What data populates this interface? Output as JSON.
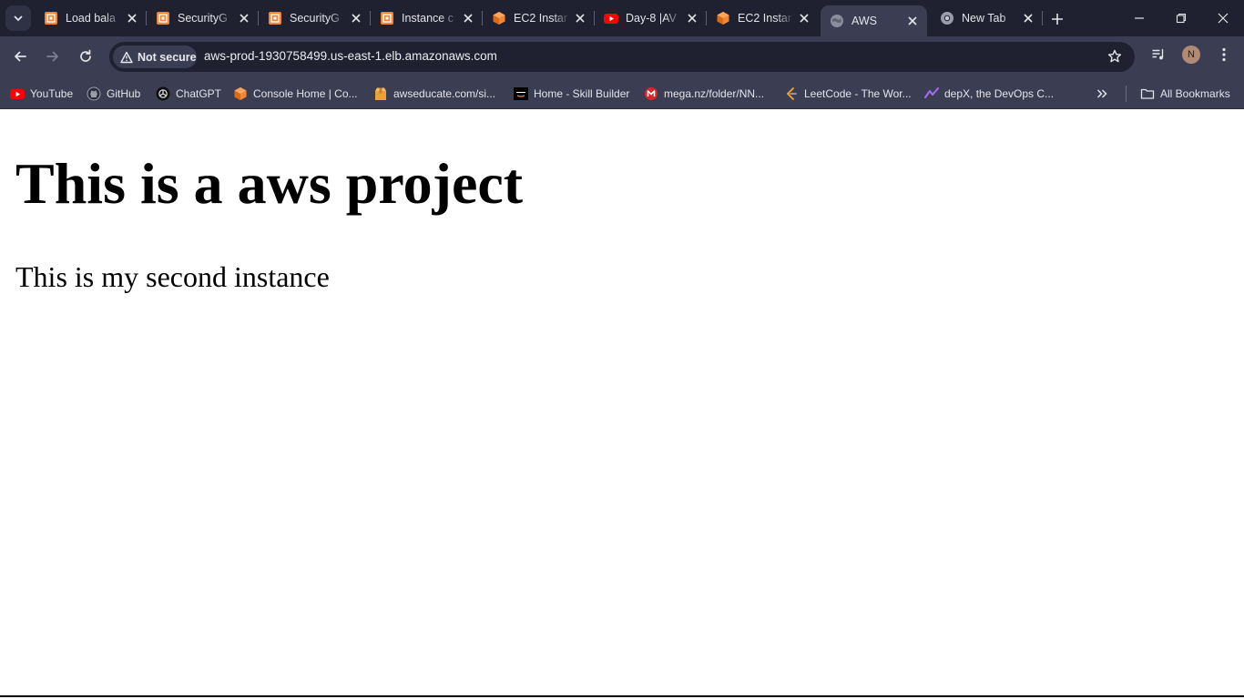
{
  "tabs": [
    {
      "title": "Load bala",
      "icon": "aws-ec2-icon"
    },
    {
      "title": "SecurityG",
      "icon": "aws-ec2-icon"
    },
    {
      "title": "SecurityG",
      "icon": "aws-ec2-icon"
    },
    {
      "title": "Instance c",
      "icon": "aws-ec2-icon"
    },
    {
      "title": "EC2 Instar",
      "icon": "aws-cube-icon"
    },
    {
      "title": "Day-8 |AV",
      "icon": "youtube-icon"
    },
    {
      "title": "EC2 Instar",
      "icon": "aws-cube-icon"
    },
    {
      "title": "AWS",
      "icon": "globe-icon",
      "active": true
    },
    {
      "title": "New Tab",
      "icon": "chrome-icon"
    }
  ],
  "omnibox": {
    "security_label": "Not secure",
    "url": "aws-prod-1930758499.us-east-1.elb.amazonaws.com"
  },
  "profile": {
    "initial": "N"
  },
  "bookmarks": [
    {
      "label": "YouTube",
      "icon": "youtube-icon"
    },
    {
      "label": "GitHub",
      "icon": "github-icon"
    },
    {
      "label": "ChatGPT",
      "icon": "chatgpt-icon"
    },
    {
      "label": "Console Home | Co...",
      "icon": "aws-cube-icon"
    },
    {
      "label": "awseducate.com/si...",
      "icon": "box-icon"
    },
    {
      "label": "Home - Skill Builder",
      "icon": "aws-logo-icon"
    },
    {
      "label": "mega.nz/folder/NN...",
      "icon": "mega-icon"
    },
    {
      "label": "LeetCode - The Wor...",
      "icon": "leetcode-icon"
    },
    {
      "label": "depX, the DevOps C...",
      "icon": "depx-icon"
    }
  ],
  "all_bookmarks_label": "All Bookmarks",
  "page": {
    "heading": "This is a aws project",
    "paragraph": "This is my second instance"
  },
  "colors": {
    "tabstrip_bg": "#1f2130",
    "toolbar_bg": "#3b3e52",
    "aws_orange": "#f58534",
    "youtube_red": "#ff0000"
  }
}
